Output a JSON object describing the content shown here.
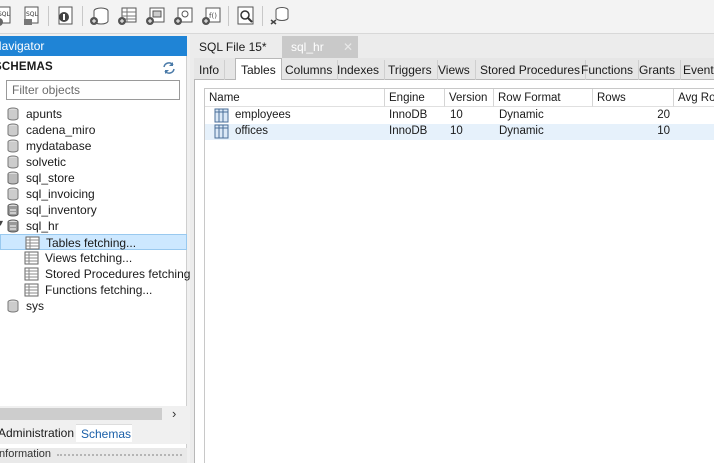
{
  "toolbar": {
    "buttons": [
      "sql-new-icon",
      "sql-open-icon",
      "inspector-icon",
      "create-schema-icon",
      "create-table-icon",
      "create-view-icon",
      "create-procedure-icon",
      "create-function-icon",
      "search-table-icon",
      "reconnect-icon"
    ]
  },
  "navigator": {
    "header": "Navigator",
    "schemas_title": "SCHEMAS",
    "filter_placeholder": "Filter objects",
    "schemas": [
      {
        "label": "apunts",
        "icon": "database-icon"
      },
      {
        "label": "cadena_miro",
        "icon": "database-icon"
      },
      {
        "label": "mydatabase",
        "icon": "database-icon"
      },
      {
        "label": "solvetic",
        "icon": "database-icon"
      },
      {
        "label": "sql_store",
        "icon": "database-icon"
      },
      {
        "label": "sql_invoicing",
        "icon": "database-icon"
      },
      {
        "label": "sql_inventory",
        "icon": "database-icon"
      },
      {
        "label": "sql_hr",
        "icon": "database-icon",
        "expanded": true
      }
    ],
    "children": [
      {
        "label": "Tables fetching...",
        "selected": true
      },
      {
        "label": "Views fetching..."
      },
      {
        "label": "Stored Procedures fetching..."
      },
      {
        "label": "Functions fetching..."
      }
    ],
    "sys_label": "sys",
    "bottom_tabs": {
      "admin": "Administration",
      "schemas": "Schemas"
    },
    "info_label": "Information"
  },
  "editor": {
    "doc_tabs": {
      "sqlfile": "SQL File 15*",
      "sqlhr": "sql_hr"
    },
    "sub_tabs": [
      "Info",
      "Tables",
      "Columns",
      "Indexes",
      "Triggers",
      "Views",
      "Stored Procedures",
      "Functions",
      "Grants",
      "Events"
    ],
    "active_sub_tab": "Tables",
    "columns": [
      "Name",
      "Engine",
      "Version",
      "Row Format",
      "Rows",
      "Avg Row Length"
    ],
    "rows": [
      {
        "name": "employees",
        "engine": "InnoDB",
        "version": "10",
        "row_format": "Dynamic",
        "rows": "20"
      },
      {
        "name": "offices",
        "engine": "InnoDB",
        "version": "10",
        "row_format": "Dynamic",
        "rows": "10"
      }
    ]
  },
  "colors": {
    "accent": "#1f84d6",
    "selection": "#cde8ff",
    "highlight_row": "#e6f1fb"
  }
}
